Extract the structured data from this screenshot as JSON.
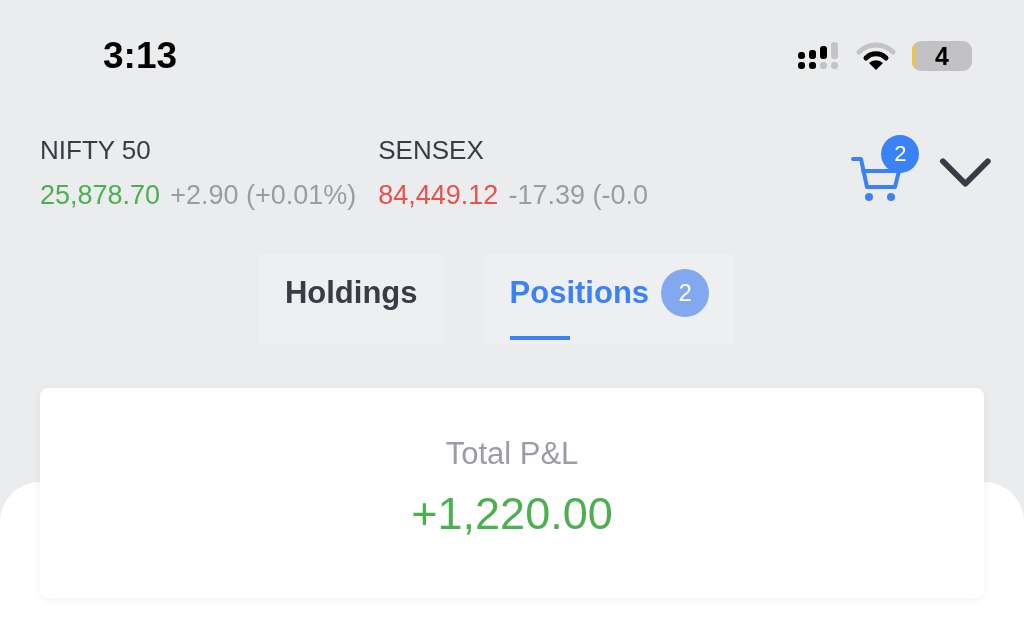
{
  "status_bar": {
    "time": "3:13",
    "battery": "4"
  },
  "indices": [
    {
      "name": "NIFTY 50",
      "value": "25,878.70",
      "change": "+2.90 (+0.01%)",
      "color": "#4caf50"
    },
    {
      "name": "SENSEX",
      "value": "84,449.12",
      "change": "-17.39 (-0.0",
      "color": "#e5534b"
    }
  ],
  "cart": {
    "badge": "2"
  },
  "tabs": [
    {
      "label": "Holdings",
      "selected": false
    },
    {
      "label": "Positions",
      "selected": true,
      "badge": "2"
    }
  ],
  "summary": {
    "label": "Total P&L",
    "value": "+1,220.00",
    "color": "#4caf50"
  }
}
